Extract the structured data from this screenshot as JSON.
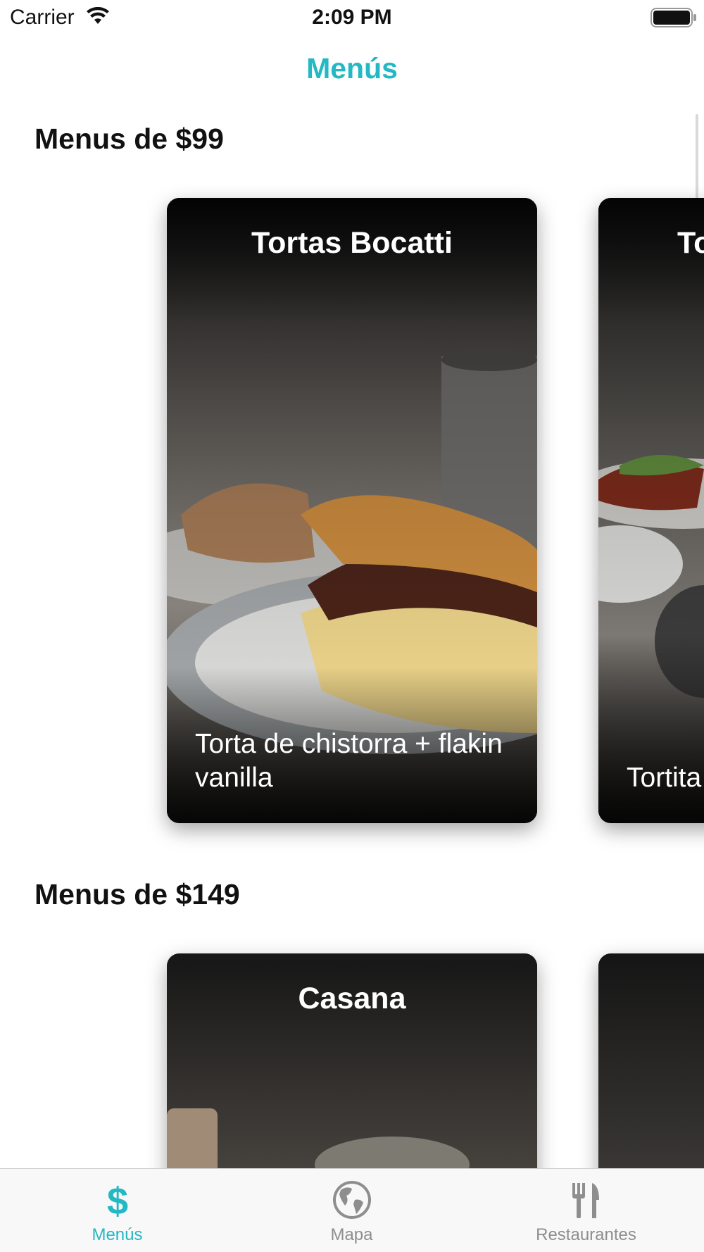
{
  "status_bar": {
    "carrier": "Carrier",
    "time": "2:09 PM",
    "wifi_icon": "wifi-icon",
    "battery_icon": "battery-icon"
  },
  "nav": {
    "title": "Menús",
    "accent_color": "#22b8c4"
  },
  "sections": [
    {
      "heading": "Menus de $99",
      "cards": [
        {
          "title": "Tortas Bocatti",
          "description": "Torta de chistorra + flakin vanilla"
        },
        {
          "title": "To",
          "description": "Tortita pirata del día"
        }
      ]
    },
    {
      "heading": "Menus de $149",
      "cards": [
        {
          "title": "Casana",
          "description": ""
        },
        {
          "title": "",
          "description": ""
        }
      ]
    }
  ],
  "tab_bar": {
    "tabs": [
      {
        "label": "Menús",
        "icon": "dollar-icon",
        "active": true
      },
      {
        "label": "Mapa",
        "icon": "globe-icon",
        "active": false
      },
      {
        "label": "Restaurantes",
        "icon": "fork-knife-icon",
        "active": false
      }
    ],
    "active_color": "#22b8c4",
    "inactive_color": "#8e8e8e"
  }
}
